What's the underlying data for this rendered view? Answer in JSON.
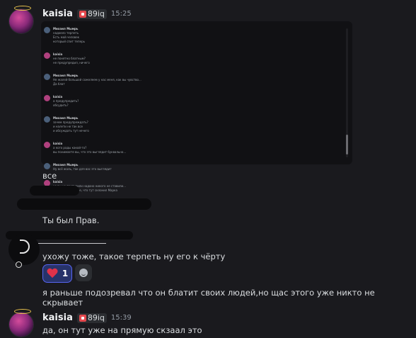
{
  "first_message": {
    "username": "kaisia",
    "tag": "89iq",
    "time": "15:25",
    "embed_lines": [
      {
        "name": "Михаил Мымрь",
        "lines": [
          "надоело терпеть",
          "Есть мой человек",
          "который спит теперь"
        ]
      },
      {
        "name": "kaisia",
        "lines": [
          "не понятно блатным?",
          "не предупредил, ничего"
        ]
      },
      {
        "name": "Михаил Мымрь",
        "lines": [
          "Не жалей большой сожелеем у нас меня, как вы чувство...",
          "Да блат"
        ]
      },
      {
        "name": "kaisia",
        "lines": [
          "а предупредить?",
          "обсудить?"
        ]
      },
      {
        "name": "Михаил Мымрь",
        "lines": [
          "зачем предупреждать?",
          "и налети не так все",
          "и обсуждать тут нечего"
        ]
      },
      {
        "name": "kaisia",
        "lines": [
          "а кого рады какой-то?",
          "вы понимаете вы, что это выглядит буквально..."
        ]
      },
      {
        "name": "Михаил Мымрь",
        "lines": [
          "Ну всё жаль, так для вас это выглядит"
        ]
      },
      {
        "name": "kaisia",
        "lines": [
          "че вы не противили надоно никого не ставили...",
          "я думала вы новее, что тут склонил Марка"
        ]
      }
    ]
  },
  "messages": {
    "m1": "все",
    "m2": "Ты был Прав.",
    "m3": "ухожу тоже, такое терпеть ну его к чёрту",
    "m4": "я раньше подозревал что он блатит своих людей,но щас этого уже никто не скрывает"
  },
  "reaction": {
    "emoji": "heart",
    "count": "1",
    "color": "#e0324a"
  },
  "second_message": {
    "username": "kaisia",
    "tag": "89iq",
    "time": "15:39",
    "text": "да, он тут уже на прямую скзаал это"
  },
  "colors": {
    "background": "#1a1a1e",
    "reaction_bg": "#27336a",
    "reaction_border": "#5865f2"
  }
}
